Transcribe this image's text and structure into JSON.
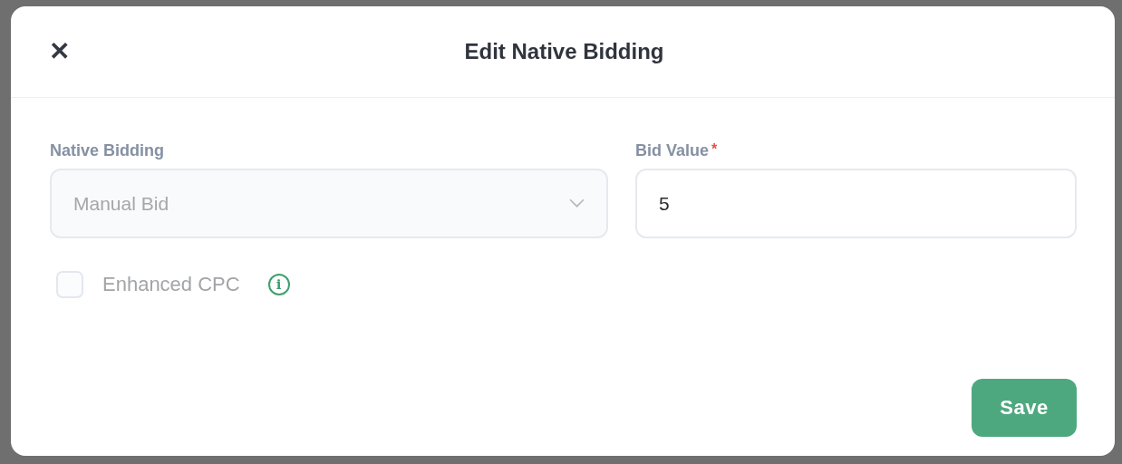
{
  "dialog": {
    "close_icon": "✕",
    "title": "Edit Native Bidding"
  },
  "fields": [
    {
      "kind": "select",
      "label": "Native Bidding",
      "value": "Manual Bid",
      "disabled": true
    },
    {
      "kind": "input",
      "label": "Bid Value",
      "required_mark": "*",
      "value": "5",
      "disabled": false
    }
  ],
  "checkbox": {
    "label": "Enhanced CPC",
    "checked": false,
    "disabled": true,
    "info_icon": "i"
  },
  "buttons": [
    {
      "label": "Save"
    }
  ]
}
